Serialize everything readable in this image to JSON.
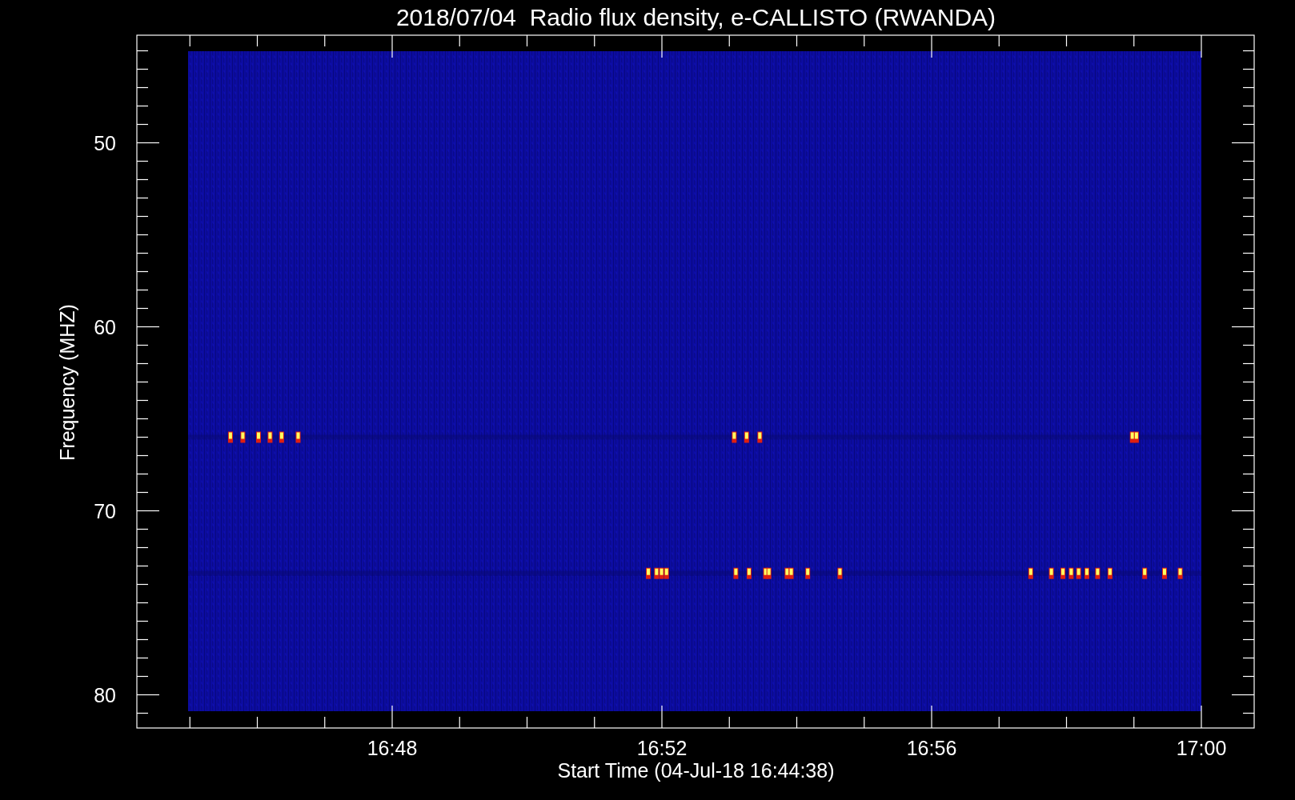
{
  "title": "2018/07/04  Radio flux density, e-CALLISTO (RWANDA)",
  "ylabel": "Frequency (MHZ)",
  "xlabel": "Start Time (04-Jul-18 16:44:38)",
  "y_tick_labels": [
    "50",
    "60",
    "70",
    "80"
  ],
  "x_tick_labels": [
    "16:48",
    "16:52",
    "16:56",
    "17:00"
  ]
}
